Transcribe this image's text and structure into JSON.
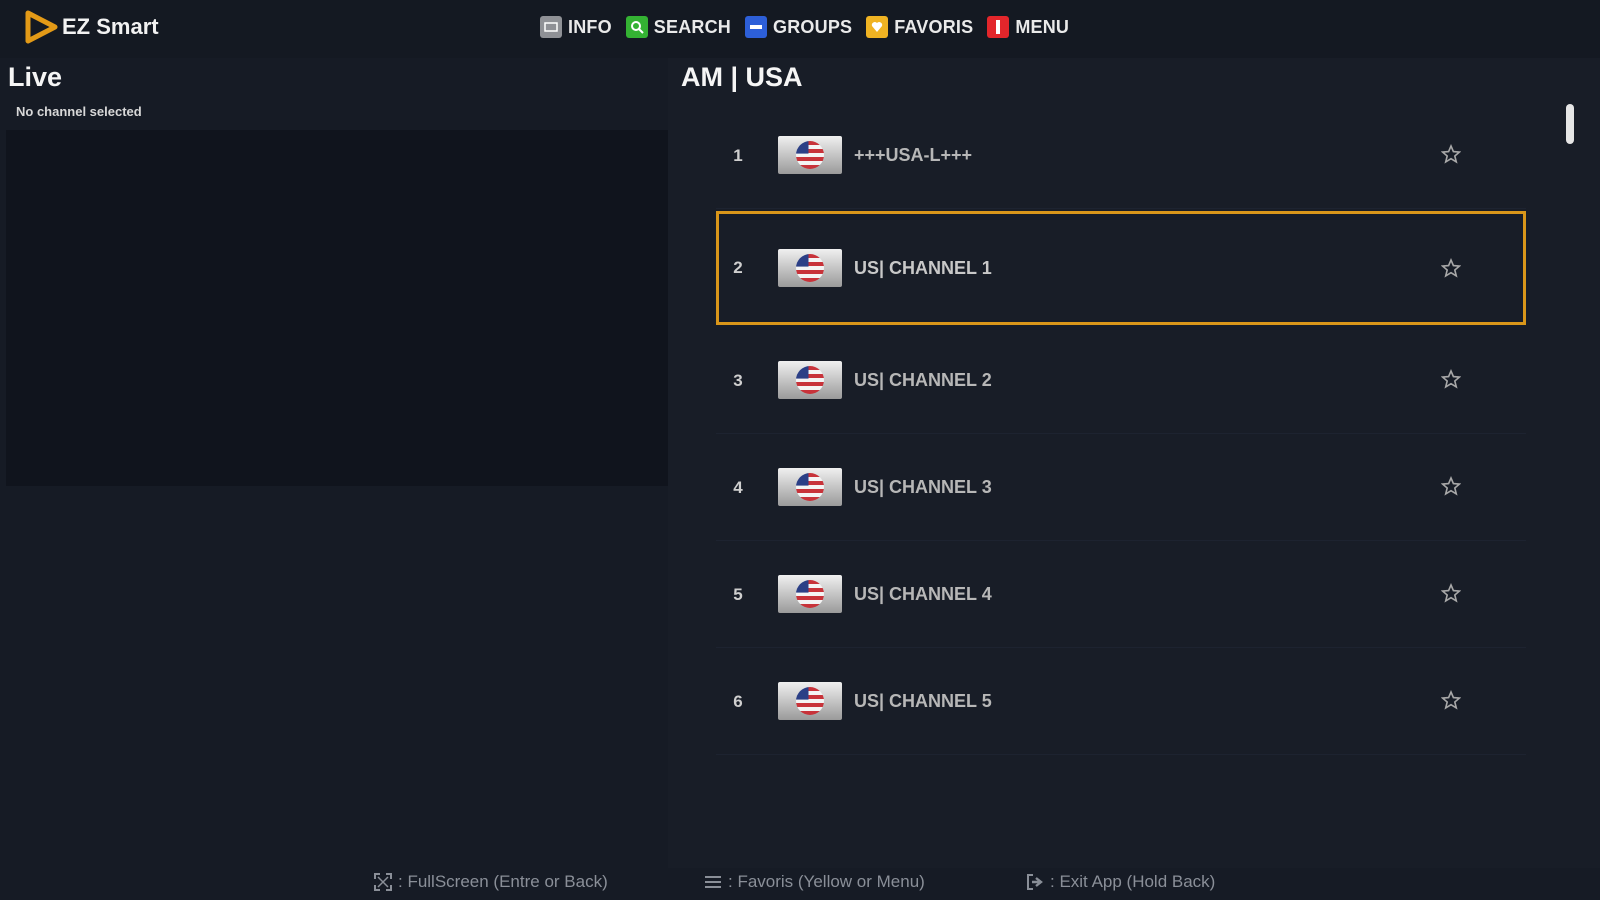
{
  "app": {
    "name": "EZ Smart"
  },
  "hotkeys": [
    {
      "label": "INFO",
      "icon": "info-icon",
      "color": "#8f9196"
    },
    {
      "label": "SEARCH",
      "icon": "search-icon",
      "color": "#34b233"
    },
    {
      "label": "GROUPS",
      "icon": "groups-icon",
      "color": "#2d5fd8"
    },
    {
      "label": "FAVORIS",
      "icon": "favorite-icon",
      "color": "#f0b323"
    },
    {
      "label": "MENU",
      "icon": "menu-icon",
      "color": "#e3262b"
    }
  ],
  "left": {
    "title": "Live",
    "status": "No channel selected"
  },
  "group": {
    "title": "AM | USA"
  },
  "channels": [
    {
      "number": "1",
      "name": "+++USA-L+++",
      "logo": "us-flag-icon"
    },
    {
      "number": "2",
      "name": "US| CHANNEL 1",
      "logo": "us-flag-icon",
      "selected": true
    },
    {
      "number": "3",
      "name": "US| CHANNEL 2",
      "logo": "us-flag-icon"
    },
    {
      "number": "4",
      "name": "US| CHANNEL 3",
      "logo": "us-flag-icon"
    },
    {
      "number": "5",
      "name": "US| CHANNEL 4",
      "logo": "us-flag-icon"
    },
    {
      "number": "6",
      "name": "US| CHANNEL 5",
      "logo": "us-flag-icon"
    }
  ],
  "footer": {
    "fullscreen": ": FullScreen (Entre or Back)",
    "favoris": ": Favoris (Yellow or Menu)",
    "exit": ": Exit App (Hold Back)"
  },
  "colors": {
    "accent": "#d9961a",
    "background": "#161b25",
    "player": "#10141d"
  }
}
